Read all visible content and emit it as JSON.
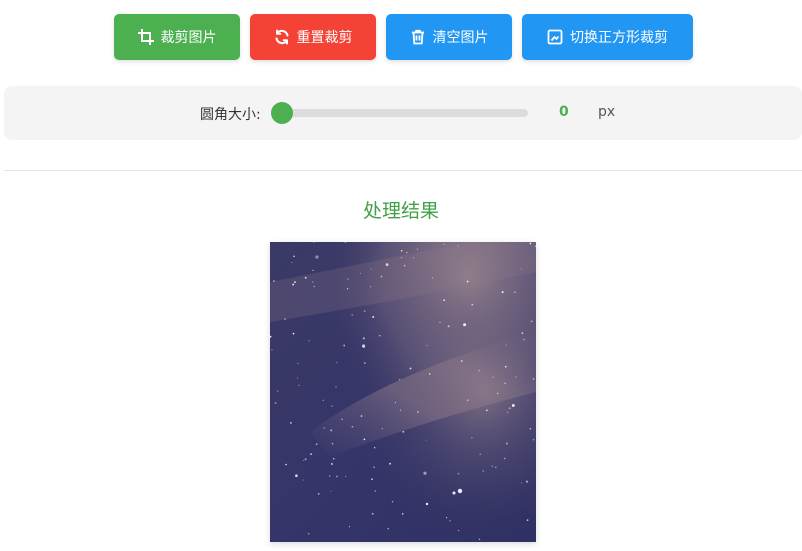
{
  "toolbar": {
    "crop_label": "裁剪图片",
    "reset_label": "重置裁剪",
    "clear_label": "清空图片",
    "toggle_label": "切换正方形裁剪"
  },
  "faint_overlay_text": "(faint, partially hidden)",
  "slider": {
    "label": "圆角大小:",
    "value": "0",
    "unit": "px",
    "level_fraction": 0.0
  },
  "result": {
    "title": "处理结果",
    "image_icon": "starry-night-sky-photo"
  },
  "colors": {
    "crop_button": "#4caf50",
    "reset_button": "#f44336",
    "clear_button": "#2196f3",
    "toggle_button": "#2196f3",
    "accent_green": "#4caf50",
    "title_green": "#43a047"
  },
  "icons": {
    "crop": "crop-icon",
    "reset": "refresh-icon",
    "clear": "trash-icon",
    "toggle": "square-crop-icon"
  }
}
